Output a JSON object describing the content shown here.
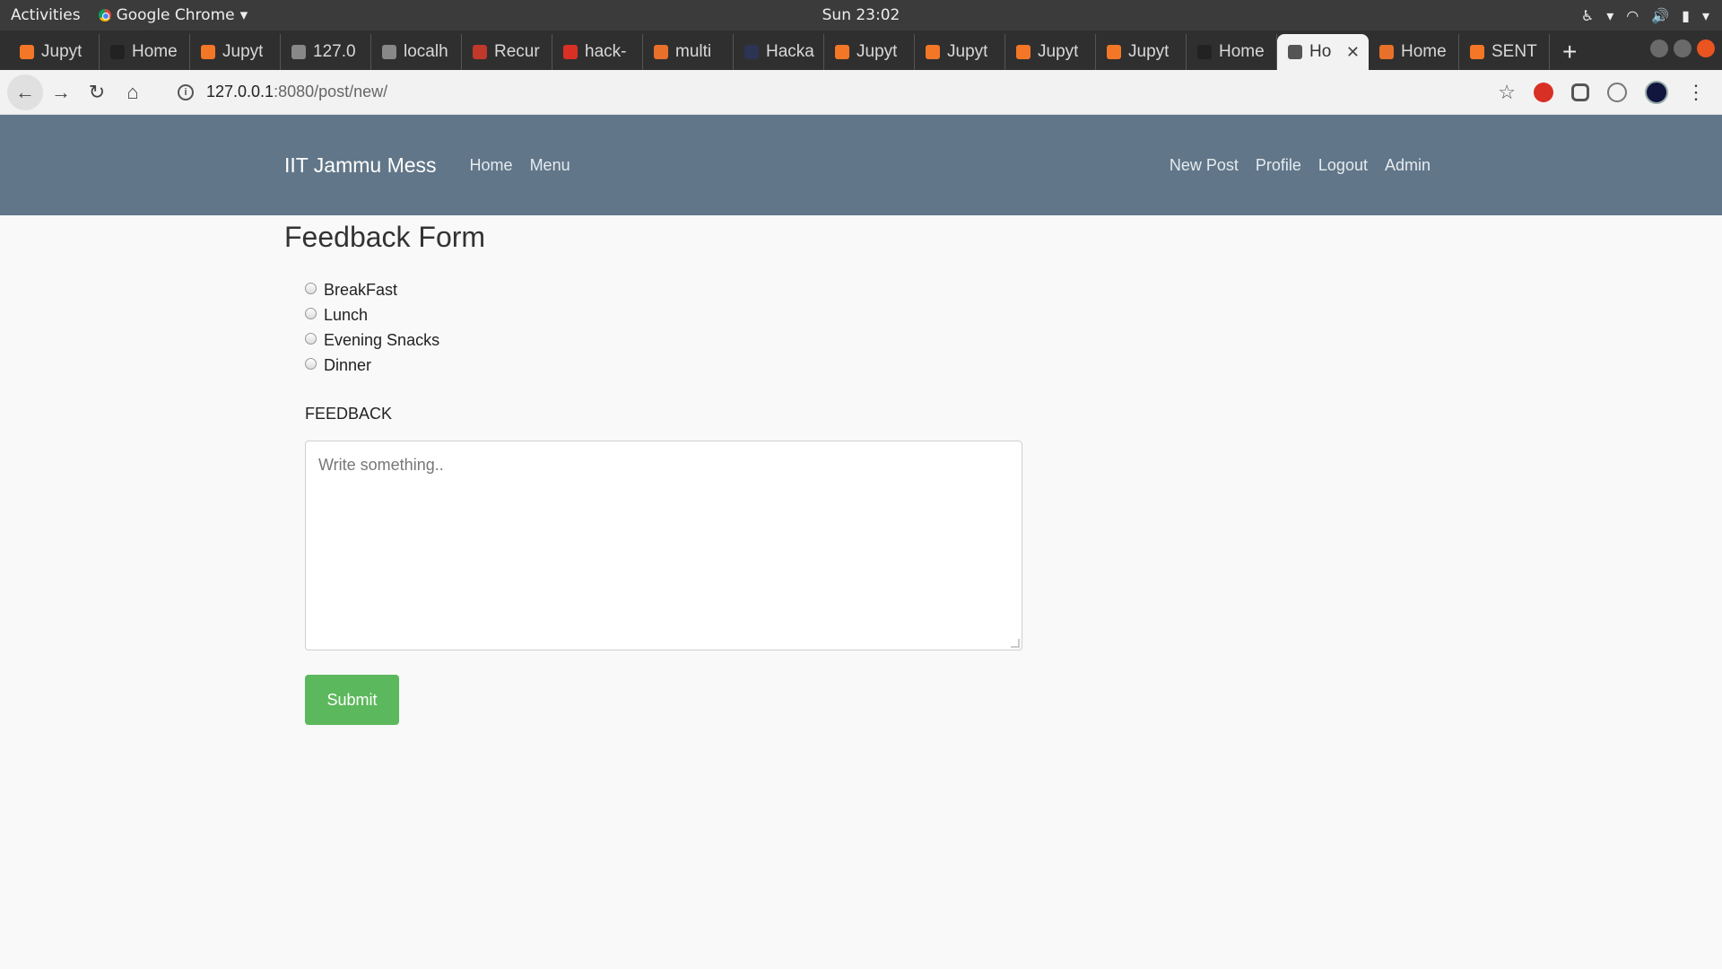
{
  "system": {
    "activities": "Activities",
    "app_name": "Google Chrome",
    "clock": "Sun 23:02"
  },
  "tabs": [
    {
      "title": "Jupyt",
      "icon": "jupyter-icon",
      "color": "#f37726"
    },
    {
      "title": "Home",
      "icon": "github-icon",
      "color": "#222222"
    },
    {
      "title": "Jupyt",
      "icon": "jupyter-icon",
      "color": "#f37726"
    },
    {
      "title": "127.0",
      "icon": "globe-icon",
      "color": "#888888"
    },
    {
      "title": "localh",
      "icon": "globe-icon",
      "color": "#888888"
    },
    {
      "title": "Recur",
      "icon": "k-icon",
      "color": "#c0392b"
    },
    {
      "title": "hack-",
      "icon": "gmail-icon",
      "color": "#d93025"
    },
    {
      "title": "multi",
      "icon": "ask-icon",
      "color": "#e8702a"
    },
    {
      "title": "Hacka",
      "icon": "hackerearth-icon",
      "color": "#2c3454"
    },
    {
      "title": "Jupyt",
      "icon": "jupyter-icon",
      "color": "#f37726"
    },
    {
      "title": "Jupyt",
      "icon": "jupyter-icon",
      "color": "#f37726"
    },
    {
      "title": "Jupyt",
      "icon": "jupyter-icon",
      "color": "#f37726"
    },
    {
      "title": "Jupyt",
      "icon": "jupyter-icon",
      "color": "#f37726"
    },
    {
      "title": "Home",
      "icon": "github-icon",
      "color": "#222222"
    },
    {
      "title": "Ho",
      "icon": "globe-icon",
      "color": "#555555",
      "active": true
    },
    {
      "title": "Home",
      "icon": "loading-icon",
      "color": "#e8702a"
    },
    {
      "title": "SENT",
      "icon": "jupyter-icon",
      "color": "#f37726"
    }
  ],
  "address": {
    "host": "127.0.0.1",
    "path": ":8080/post/new/"
  },
  "site": {
    "brand": "IIT Jammu Mess",
    "nav_left": [
      "Home",
      "Menu"
    ],
    "nav_right": [
      "New Post",
      "Profile",
      "Logout",
      "Admin"
    ]
  },
  "form": {
    "title": "Feedback Form",
    "meal_options": [
      "BreakFast",
      "Lunch",
      "Evening Snacks",
      "Dinner"
    ],
    "feedback_label": "FEEDBACK",
    "feedback_placeholder": "Write something..",
    "submit_label": "Submit"
  },
  "colors": {
    "navbar": "#617688",
    "submit": "#5cb85c"
  }
}
